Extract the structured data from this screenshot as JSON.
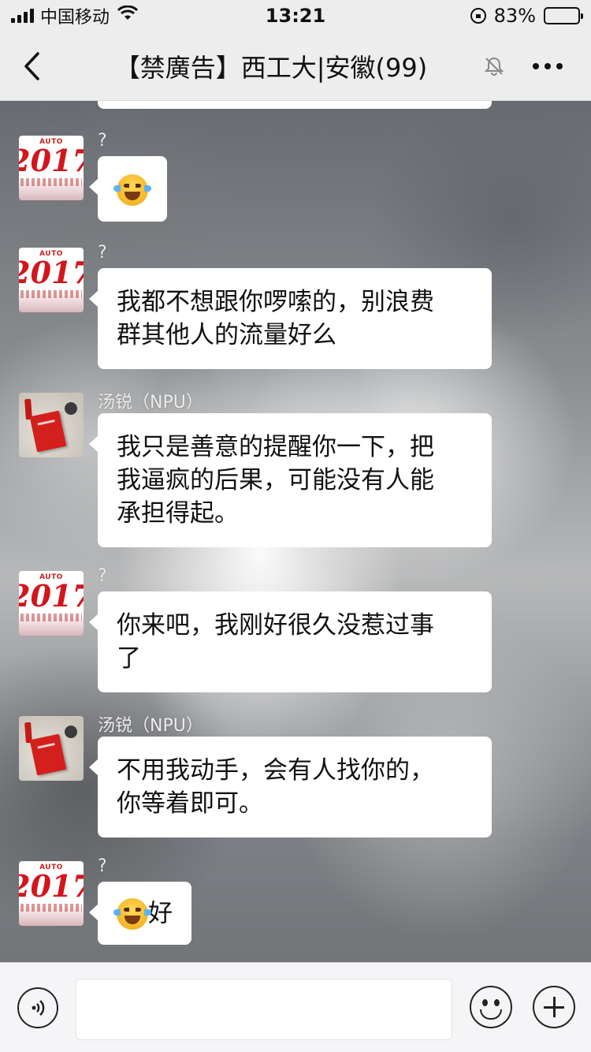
{
  "status_bar": {
    "carrier": "中国移动",
    "time": "13:21",
    "battery": "83%",
    "battery_level": 0.83
  },
  "nav": {
    "title": "【禁廣告】西工大|安徽(99)"
  },
  "messages": [
    {
      "sender": "?",
      "avatar": "avatar-2017",
      "text": "",
      "emoji": "crying-laughing-emoji"
    },
    {
      "sender": "?",
      "avatar": "avatar-2017",
      "lines": [
        "我都不想跟你啰嗦的，别浪费",
        "群其他人的流量好么"
      ]
    },
    {
      "sender": "汤锐（NPU）",
      "avatar": "avatar-book",
      "lines": [
        "我只是善意的提醒你一下，把",
        "我逼疯的后果，可能没有人能",
        "承担得起。"
      ]
    },
    {
      "sender": "?",
      "avatar": "avatar-2017",
      "lines": [
        "你来吧，我刚好很久没惹过事",
        "了"
      ]
    },
    {
      "sender": "汤锐（NPU）",
      "avatar": "avatar-book",
      "lines": [
        "不用我动手，会有人找你的，",
        "你等着即可。"
      ]
    },
    {
      "sender": "?",
      "avatar": "avatar-2017",
      "text": "好",
      "emoji": "crying-laughing-emoji"
    }
  ],
  "avatar_text": {
    "top_label": "AUTO",
    "year": "2017"
  },
  "input": {
    "value": ""
  }
}
